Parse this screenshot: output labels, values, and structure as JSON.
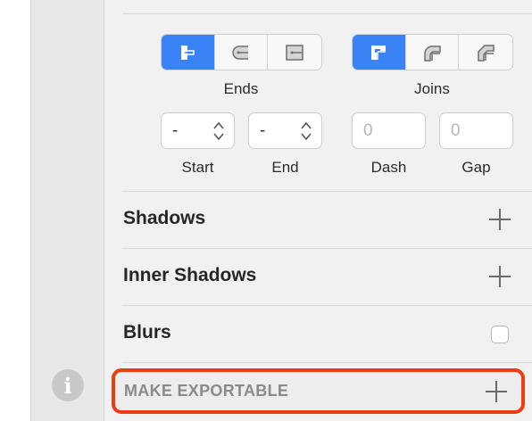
{
  "ends": {
    "label": "Ends",
    "options": [
      {
        "icon": "butt-cap-icon",
        "active": true
      },
      {
        "icon": "round-cap-icon",
        "active": false
      },
      {
        "icon": "square-cap-icon",
        "active": false
      }
    ]
  },
  "joins": {
    "label": "Joins",
    "options": [
      {
        "icon": "miter-join-icon",
        "active": true
      },
      {
        "icon": "round-join-icon",
        "active": false
      },
      {
        "icon": "bevel-join-icon",
        "active": false
      }
    ]
  },
  "arrows": {
    "start": {
      "label": "Start",
      "value": "-"
    },
    "end": {
      "label": "End",
      "value": "-"
    }
  },
  "dash": {
    "label": "Dash",
    "placeholder": "0"
  },
  "gap": {
    "label": "Gap",
    "placeholder": "0"
  },
  "sections": {
    "shadows": "Shadows",
    "inner_shadows": "Inner Shadows",
    "blurs": "Blurs",
    "export": "MAKE EXPORTABLE"
  },
  "colors": {
    "accent": "#3a83f6",
    "highlight": "#ef3b12"
  },
  "info_icon": "i"
}
